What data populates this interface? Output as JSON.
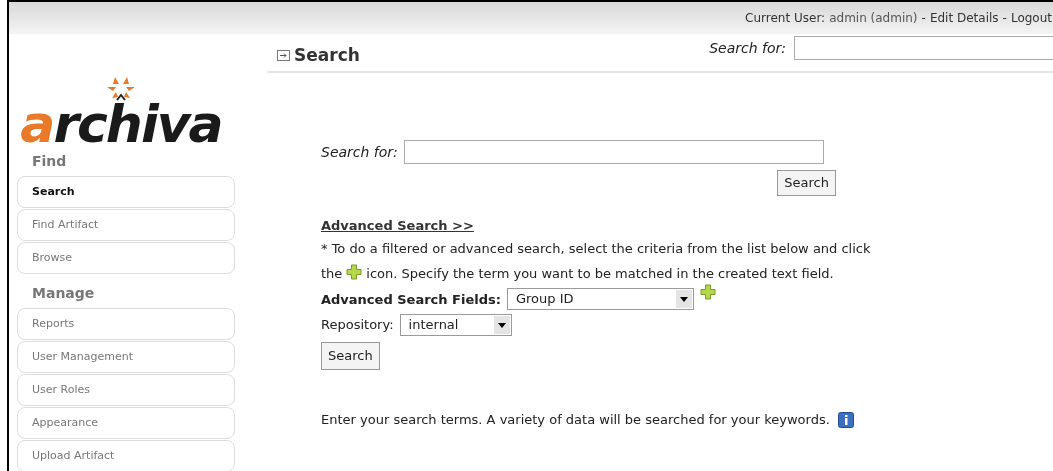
{
  "top_bar": {
    "user_label": "Current User:",
    "user_name": "admin (admin)",
    "separator_1": "-",
    "edit_link": "Edit Details",
    "separator_2": "-",
    "logout_link": "Logout"
  },
  "logo": {
    "text_accent": "a",
    "text_rest": "rchiva"
  },
  "header": {
    "title": "Search",
    "search_label": "Search for:"
  },
  "sidebar": [
    {
      "heading": "Find",
      "items": [
        {
          "label": "Search",
          "selected": true
        },
        {
          "label": "Find Artifact",
          "selected": false
        },
        {
          "label": "Browse",
          "selected": false
        }
      ]
    },
    {
      "heading": "Manage",
      "items": [
        {
          "label": "Reports",
          "selected": false
        },
        {
          "label": "User Management",
          "selected": false
        },
        {
          "label": "User Roles",
          "selected": false
        },
        {
          "label": "Appearance",
          "selected": false
        },
        {
          "label": "Upload Artifact",
          "selected": false
        }
      ]
    }
  ],
  "search_form": {
    "label": "Search for:",
    "button": "Search"
  },
  "advanced": {
    "link": "Advanced Search >>",
    "instruction_line_1": "* To do a filtered or advanced search, select the criteria from the list below and click",
    "instruction_before": "the",
    "instruction_after": "icon. Specify the term you want to be matched in the created text field.",
    "fields_label": "Advanced Search Fields:",
    "fields_value": "Group ID",
    "repository_label": "Repository:",
    "repository_value": "internal",
    "button": "Search"
  },
  "footer_text": "Enter your search terms. A variety of data will be searched for your keywords."
}
